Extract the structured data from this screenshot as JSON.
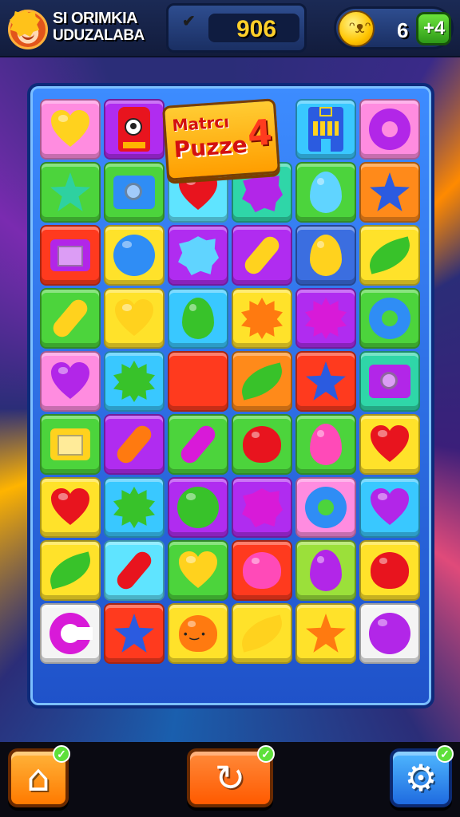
{
  "player": {
    "name_line1": "SI ORIMKIA",
    "name_line2": "UDUZALABA",
    "avatar_icon": "girl-avatar-icon"
  },
  "score": {
    "value": "906",
    "icon": "star-badge-check-icon"
  },
  "lives": {
    "value": "6",
    "icon": "coin-face-icon",
    "add_label": "+4"
  },
  "title_tile": {
    "line1": "Matrcı",
    "line2": "Puzze",
    "number": "4"
  },
  "board": {
    "rows": [
      [
        {
          "bg": "c-pink",
          "shape": "heart",
          "color": "yellow",
          "name": "heart-piece"
        },
        {
          "bg": "c-purple",
          "shape": "character",
          "color": "red",
          "name": "robot-character-piece"
        },
        {
          "bg": "title",
          "shape": "title",
          "color": "",
          "name": "title-tile"
        },
        {
          "bg": "title",
          "shape": "title",
          "color": "",
          "name": "title-tile"
        },
        {
          "bg": "c-blue",
          "shape": "tower",
          "color": "navy",
          "name": "tower-piece"
        },
        {
          "bg": "c-pink",
          "shape": "ring",
          "color": "purple",
          "name": "donut-piece"
        }
      ],
      [
        {
          "bg": "c-green",
          "shape": "star",
          "color": "teal",
          "name": "star-piece"
        },
        {
          "bg": "c-green",
          "shape": "camera",
          "color": "blue",
          "name": "camera-piece"
        },
        {
          "bg": "c-cyan",
          "shape": "heart",
          "color": "red",
          "name": "heart-piece"
        },
        {
          "bg": "c-teal",
          "shape": "blob",
          "color": "purple",
          "name": "flower-piece"
        },
        {
          "bg": "c-green",
          "shape": "drop",
          "color": "lightblue",
          "name": "drop-piece"
        },
        {
          "bg": "c-orange",
          "shape": "star",
          "color": "navy",
          "name": "star-piece"
        }
      ],
      [
        {
          "bg": "c-red",
          "shape": "box",
          "color": "purple",
          "name": "tv-piece"
        },
        {
          "bg": "c-yellow",
          "shape": "circle",
          "color": "blue",
          "name": "bomb-piece"
        },
        {
          "bg": "c-purple",
          "shape": "blob",
          "color": "lightblue",
          "name": "flower-piece"
        },
        {
          "bg": "c-purple",
          "shape": "capsule",
          "color": "yellow",
          "name": "bottle-piece"
        },
        {
          "bg": "c-navy",
          "shape": "drop",
          "color": "yellow",
          "name": "balloon-piece"
        },
        {
          "bg": "c-yellow",
          "shape": "leaf",
          "color": "green",
          "name": "leaf-piece"
        }
      ],
      [
        {
          "bg": "c-green",
          "shape": "capsule",
          "color": "yellow",
          "name": "crayon-piece"
        },
        {
          "bg": "c-yellow",
          "shape": "heart",
          "color": "yellow",
          "name": "heart-piece"
        },
        {
          "bg": "c-blue",
          "shape": "drop",
          "color": "green",
          "name": "balloon-piece"
        },
        {
          "bg": "c-yellow",
          "shape": "burst",
          "color": "orange",
          "name": "cookie-piece"
        },
        {
          "bg": "c-purple",
          "shape": "burst",
          "color": "magenta",
          "name": "spiky-piece"
        },
        {
          "bg": "c-green",
          "shape": "ring",
          "color": "blue",
          "name": "ring-piece"
        }
      ],
      [
        {
          "bg": "c-pink",
          "shape": "heart",
          "color": "purple",
          "name": "heart-piece"
        },
        {
          "bg": "c-blue",
          "shape": "burst",
          "color": "green",
          "name": "gear-piece"
        },
        {
          "bg": "c-red",
          "shape": "capsule",
          "color": "white",
          "name": "crayon-piece"
        },
        {
          "bg": "c-orange",
          "shape": "leaf",
          "color": "green",
          "name": "leaf-piece"
        },
        {
          "bg": "c-red",
          "shape": "star",
          "color": "navy",
          "name": "star-piece"
        },
        {
          "bg": "c-teal",
          "shape": "camera",
          "color": "purple",
          "name": "camera-piece"
        }
      ],
      [
        {
          "bg": "c-green",
          "shape": "box",
          "color": "yellow",
          "name": "tv-piece"
        },
        {
          "bg": "c-purple",
          "shape": "capsule",
          "color": "orange",
          "name": "crayon-piece"
        },
        {
          "bg": "c-green",
          "shape": "capsule",
          "color": "magenta",
          "name": "bottle-piece"
        },
        {
          "bg": "c-green",
          "shape": "fruit",
          "color": "red",
          "name": "strawberry-piece"
        },
        {
          "bg": "c-green",
          "shape": "drop",
          "color": "pink",
          "name": "lollipop-piece"
        },
        {
          "bg": "c-yellow",
          "shape": "heart",
          "color": "red",
          "name": "heart-piece"
        }
      ],
      [
        {
          "bg": "c-yellow",
          "shape": "heart",
          "color": "red",
          "name": "heart-piece"
        },
        {
          "bg": "c-blue",
          "shape": "burst",
          "color": "green",
          "name": "gear-piece"
        },
        {
          "bg": "c-purple",
          "shape": "circle",
          "color": "green",
          "name": "ball-piece"
        },
        {
          "bg": "c-purple",
          "shape": "blob",
          "color": "magenta",
          "name": "flower-piece"
        },
        {
          "bg": "c-pink",
          "shape": "ring",
          "color": "blue",
          "name": "shell-piece"
        },
        {
          "bg": "c-blue",
          "shape": "heart",
          "color": "purple",
          "name": "heart-piece"
        }
      ],
      [
        {
          "bg": "c-yellow",
          "shape": "leaf",
          "color": "green",
          "name": "leaf-piece"
        },
        {
          "bg": "c-cyan",
          "shape": "capsule",
          "color": "red",
          "name": "crayon-piece"
        },
        {
          "bg": "c-green",
          "shape": "heart",
          "color": "yellow",
          "name": "heart-piece"
        },
        {
          "bg": "c-red",
          "shape": "fruit",
          "color": "pink",
          "name": "strawberry-piece"
        },
        {
          "bg": "c-lime",
          "shape": "drop",
          "color": "purple",
          "name": "flower-piece"
        },
        {
          "bg": "c-yellow",
          "shape": "fruit",
          "color": "red",
          "name": "apple-piece"
        }
      ],
      [
        {
          "bg": "c-white",
          "shape": "c",
          "color": "magenta",
          "name": "c-letter-piece"
        },
        {
          "bg": "c-red",
          "shape": "star",
          "color": "navy",
          "name": "star-piece"
        },
        {
          "bg": "c-yellow",
          "shape": "fruit",
          "color": "orange",
          "name": "tomato-face-piece"
        },
        {
          "bg": "c-yellow",
          "shape": "leaf",
          "color": "yellow",
          "name": "banana-piece"
        },
        {
          "bg": "c-yellow",
          "shape": "star",
          "color": "orange",
          "name": "star-piece"
        },
        {
          "bg": "c-white",
          "shape": "circle",
          "color": "purple",
          "name": "ball-piece"
        }
      ]
    ]
  },
  "bottom_bar": {
    "home": {
      "icon": "home-icon",
      "glyph": "⌂",
      "badge": "✓"
    },
    "hint": {
      "icon": "hint-hook-icon",
      "glyph": "↻",
      "badge": "✓"
    },
    "settings": {
      "icon": "gear-icon",
      "glyph": "⚙",
      "badge": "✓"
    }
  }
}
